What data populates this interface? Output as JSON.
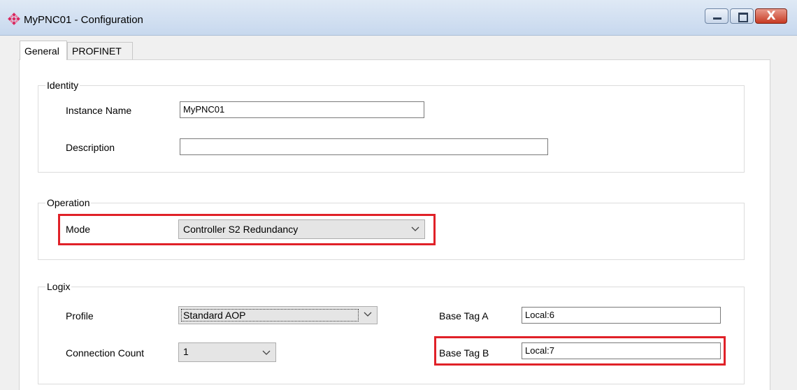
{
  "window": {
    "title": "MyPNC01 - Configuration",
    "icon": "diamond-logo-icon",
    "controls": [
      "minimize-icon",
      "maximize-icon",
      "close-icon"
    ],
    "close_glyph": "X"
  },
  "tabs": [
    {
      "label": "General",
      "active": true
    },
    {
      "label": "PROFINET",
      "active": false
    }
  ],
  "identity": {
    "legend": "Identity",
    "instance_name_label": "Instance Name",
    "instance_name_value": "MyPNC01",
    "description_label": "Description",
    "description_value": ""
  },
  "operation": {
    "legend": "Operation",
    "mode_label": "Mode",
    "mode_value": "Controller S2 Redundancy"
  },
  "logix": {
    "legend": "Logix",
    "profile_label": "Profile",
    "profile_value": "Standard AOP",
    "connection_count_label": "Connection Count",
    "connection_count_value": "1",
    "base_tag_a_label": "Base Tag A",
    "base_tag_a_value": "Local:6",
    "base_tag_b_label": "Base Tag B",
    "base_tag_b_value": "Local:7"
  },
  "colors": {
    "highlight": "#e02128",
    "title_gradient_top": "#dfe9f5",
    "close_button": "#c73a23"
  }
}
